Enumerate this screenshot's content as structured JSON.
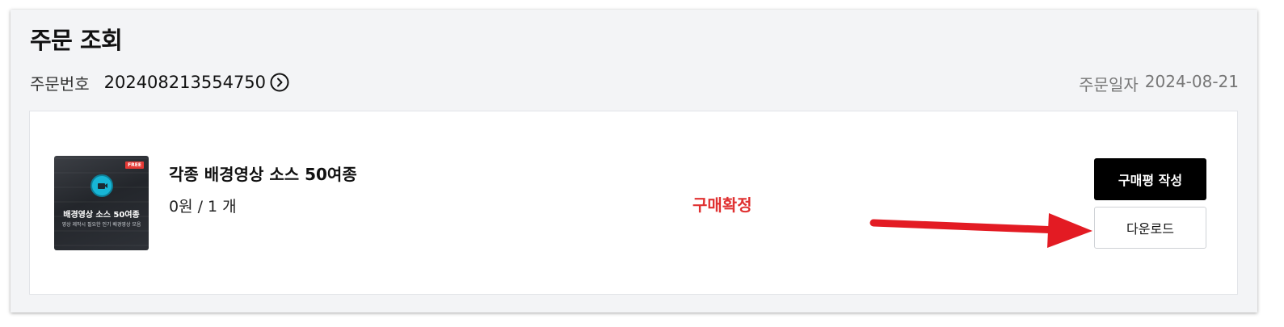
{
  "page": {
    "title": "주문 조회"
  },
  "order": {
    "number_label": "주문번호",
    "number": "202408213554750",
    "date_label": "주문일자",
    "date": "2024-08-21"
  },
  "product": {
    "thumbnail": {
      "badge": "FREE",
      "title": "배경영상 소스 50여종",
      "subtitle": "영상 제작시 필요한 인기 배경영상 모음",
      "icon": "video-camera-icon"
    },
    "name": "각종 배경영상 소스 50여종",
    "price_qty": "0원 / 1 개",
    "status": "구매확정"
  },
  "actions": {
    "review_label": "구매평 작성",
    "download_label": "다운로드"
  },
  "colors": {
    "status": "#e03131",
    "annotation_arrow": "#e31b23",
    "primary_button": "#000000"
  }
}
